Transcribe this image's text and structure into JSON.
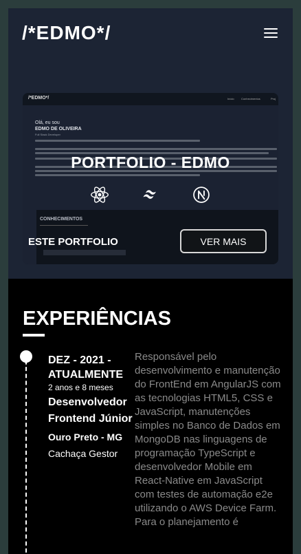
{
  "header": {
    "logo": "/*EDMO*/",
    "menu_icon": "hamburger-menu-icon"
  },
  "portfolio_card": {
    "title": "PORTFOLIO - EDMO",
    "label": "ESTE PORTFOLIO",
    "button": "VER MAIS",
    "tech_icons": [
      "react-icon",
      "tailwind-icon",
      "nextjs-icon"
    ],
    "preview": {
      "logo": "/*EDMO*/",
      "nav_links": [
        "Início",
        "Conhecimentos",
        "Proj"
      ],
      "greeting": "Olá, eu sou",
      "name": "EDMO DE OLIVEIRA",
      "subtitle": "Full Stack Developer",
      "section": "CONHECIMENTOS"
    }
  },
  "experiences": {
    "title": "EXPERIÊNCIAS",
    "items": [
      {
        "date": "DEZ - 2021 - ATUALMENTE",
        "duration": "2 anos e 8 meses",
        "role": "Desenvolvedor Frontend Júnior",
        "location": "Ouro Preto - MG",
        "company": "Cachaça Gestor",
        "description": "Responsável pelo desenvolvimento e manutenção do FrontEnd em AngularJS com as tecnologias HTML5, CSS e JavaScript, manutenções simples no Banco de Dados em MongoDB nas linguagens de programação TypeScript e desenvolvedor Mobile em React-Native em JavaScript com testes de automação e2e utilizando o AWS Device Farm. Para o planejamento é"
      }
    ]
  },
  "colors": {
    "page_bg": "#2b3d3c",
    "frame_bg": "#1c2434",
    "section_bg": "#000000",
    "text": "#ffffff",
    "muted_text": "#8a8a8a"
  }
}
